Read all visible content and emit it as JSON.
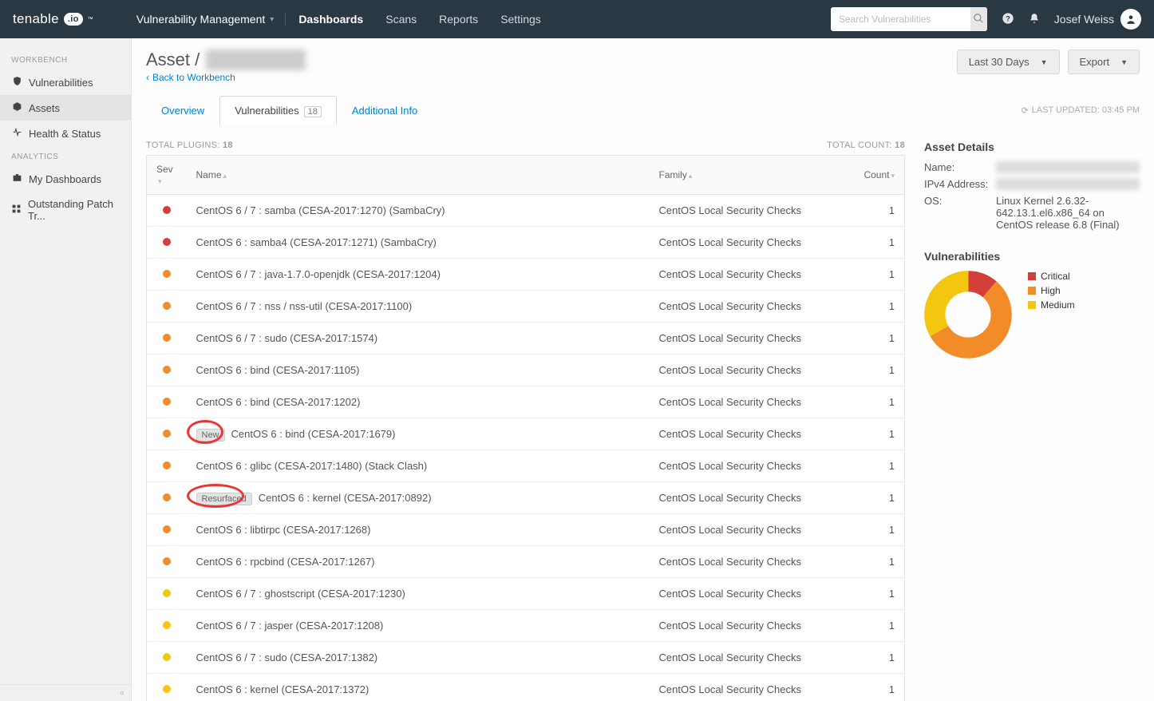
{
  "colors": {
    "critical": "#d43f3a",
    "high": "#f28c28",
    "medium": "#f3c60f"
  },
  "header": {
    "brand": "tenable",
    "brand_suffix": ".io",
    "app": "Vulnerability Management",
    "nav": [
      {
        "label": "Dashboards",
        "active": true
      },
      {
        "label": "Scans"
      },
      {
        "label": "Reports"
      },
      {
        "label": "Settings"
      }
    ],
    "search_placeholder": "Search Vulnerabilities",
    "user_name": "Josef Weiss"
  },
  "sidebar": {
    "sections": [
      {
        "title": "WORKBENCH",
        "items": [
          {
            "icon": "shield",
            "label": "Vulnerabilities"
          },
          {
            "icon": "cube",
            "label": "Assets",
            "active": true
          },
          {
            "icon": "pulse",
            "label": "Health & Status"
          }
        ]
      },
      {
        "title": "ANALYTICS",
        "items": [
          {
            "icon": "briefcase",
            "label": "My Dashboards"
          },
          {
            "icon": "grid",
            "label": "Outstanding Patch Tr..."
          }
        ]
      }
    ]
  },
  "page": {
    "breadcrumb_prefix": "Asset /",
    "breadcrumb_value": "████████",
    "back_label": "Back to Workbench",
    "time_filter": "Last 30 Days",
    "export_label": "Export",
    "tabs": [
      {
        "label": "Overview"
      },
      {
        "label": "Vulnerabilities",
        "count": "18",
        "active": true
      },
      {
        "label": "Additional Info"
      }
    ],
    "last_updated": "LAST UPDATED: 03:45 PM"
  },
  "table": {
    "total_plugins_label": "TOTAL PLUGINS:",
    "total_plugins": "18",
    "total_count_label": "TOTAL COUNT:",
    "total_count": "18",
    "columns": {
      "sev": "Sev",
      "name": "Name",
      "family": "Family",
      "count": "Count"
    },
    "rows": [
      {
        "sev": "critical",
        "name": "CentOS 6 / 7 : samba (CESA-2017:1270) (SambaCry)",
        "family": "CentOS Local Security Checks",
        "count": 1
      },
      {
        "sev": "critical",
        "name": "CentOS 6 : samba4 (CESA-2017:1271) (SambaCry)",
        "family": "CentOS Local Security Checks",
        "count": 1
      },
      {
        "sev": "high",
        "name": "CentOS 6 / 7 : java-1.7.0-openjdk (CESA-2017:1204)",
        "family": "CentOS Local Security Checks",
        "count": 1
      },
      {
        "sev": "high",
        "name": "CentOS 6 / 7 : nss / nss-util (CESA-2017:1100)",
        "family": "CentOS Local Security Checks",
        "count": 1
      },
      {
        "sev": "high",
        "name": "CentOS 6 / 7 : sudo (CESA-2017:1574)",
        "family": "CentOS Local Security Checks",
        "count": 1
      },
      {
        "sev": "high",
        "name": "CentOS 6 : bind (CESA-2017:1105)",
        "family": "CentOS Local Security Checks",
        "count": 1
      },
      {
        "sev": "high",
        "name": "CentOS 6 : bind (CESA-2017:1202)",
        "family": "CentOS Local Security Checks",
        "count": 1
      },
      {
        "sev": "high",
        "badge": "New",
        "name": "CentOS 6 : bind (CESA-2017:1679)",
        "family": "CentOS Local Security Checks",
        "count": 1,
        "annot": true
      },
      {
        "sev": "high",
        "name": "CentOS 6 : glibc (CESA-2017:1480) (Stack Clash)",
        "family": "CentOS Local Security Checks",
        "count": 1
      },
      {
        "sev": "high",
        "badge": "Resurfaced",
        "name": "CentOS 6 : kernel (CESA-2017:0892)",
        "family": "CentOS Local Security Checks",
        "count": 1,
        "annot": true
      },
      {
        "sev": "high",
        "name": "CentOS 6 : libtirpc (CESA-2017:1268)",
        "family": "CentOS Local Security Checks",
        "count": 1
      },
      {
        "sev": "high",
        "name": "CentOS 6 : rpcbind (CESA-2017:1267)",
        "family": "CentOS Local Security Checks",
        "count": 1
      },
      {
        "sev": "medium",
        "name": "CentOS 6 / 7 : ghostscript (CESA-2017:1230)",
        "family": "CentOS Local Security Checks",
        "count": 1
      },
      {
        "sev": "medium",
        "name": "CentOS 6 / 7 : jasper (CESA-2017:1208)",
        "family": "CentOS Local Security Checks",
        "count": 1
      },
      {
        "sev": "medium",
        "name": "CentOS 6 / 7 : sudo (CESA-2017:1382)",
        "family": "CentOS Local Security Checks",
        "count": 1
      },
      {
        "sev": "medium",
        "name": "CentOS 6 : kernel (CESA-2017:1372)",
        "family": "CentOS Local Security Checks",
        "count": 1
      }
    ]
  },
  "details": {
    "title": "Asset Details",
    "fields": [
      {
        "k": "Name:",
        "v": "████████",
        "redacted": true
      },
      {
        "k": "IPv4 Address:",
        "v": "███.███.███.███",
        "redacted": true
      },
      {
        "k": "OS:",
        "v": "Linux Kernel 2.6.32-642.13.1.el6.x86_64 on CentOS release 6.8 (Final)"
      }
    ],
    "vuln_title": "Vulnerabilities",
    "legend": [
      {
        "label": "Critical",
        "key": "critical"
      },
      {
        "label": "High",
        "key": "high"
      },
      {
        "label": "Medium",
        "key": "medium"
      }
    ]
  },
  "chart_data": {
    "type": "pie",
    "title": "Vulnerabilities",
    "series": [
      {
        "name": "Critical",
        "value": 2
      },
      {
        "name": "High",
        "value": 10
      },
      {
        "name": "Medium",
        "value": 6
      }
    ]
  }
}
